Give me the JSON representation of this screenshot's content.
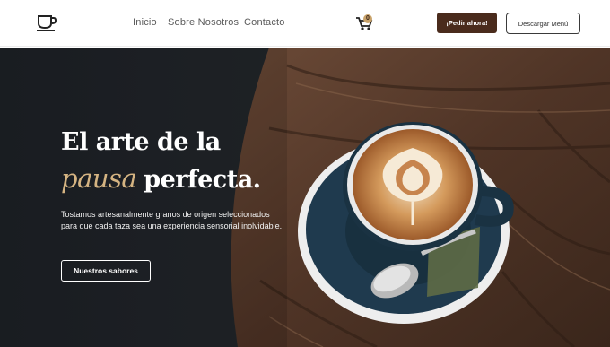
{
  "brand": {
    "logo_icon": "coffee-cup-icon"
  },
  "nav": {
    "links": [
      {
        "label": "Inicio"
      },
      {
        "label": "Sobre Nosotros"
      },
      {
        "label": "Contacto"
      }
    ]
  },
  "cart": {
    "icon": "shopping-cart-icon",
    "count": "0"
  },
  "header_actions": {
    "order_label": "¡Pedir ahora!",
    "menu_label": "Descargar Menú"
  },
  "hero": {
    "title_line1": "El arte de la",
    "title_accent": "pausa",
    "title_line2_rest": "perfecta.",
    "description": "Tostamos artesanalmente granos de origen seleccionados para que cada taza sea una experiencia sensorial inolvidable.",
    "cta_label": "Nuestros sabores"
  },
  "colors": {
    "brand_brown": "#4a2b1c",
    "accent_gold": "#d5b482",
    "cup_blue": "#1f3a4e"
  }
}
